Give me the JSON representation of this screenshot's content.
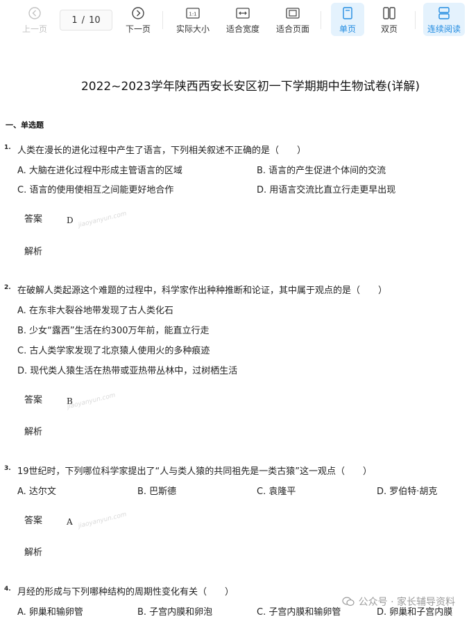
{
  "toolbar": {
    "prev_label": "上一页",
    "page_current": "1",
    "page_sep": "/",
    "page_total": "10",
    "next_label": "下一页",
    "actual_size_label": "实际大小",
    "actual_size_icon_text": "1:1",
    "fit_width_label": "适合宽度",
    "fit_page_label": "适合页面",
    "single_page_label": "单页",
    "double_page_label": "双页",
    "continuous_label": "连续阅读",
    "accent_color": "#1f8ae0"
  },
  "document": {
    "title": "2022~2023学年陕西西安长安区初一下学期期中生物试卷(详解)",
    "section": "一、单选题",
    "answer_label": "答案",
    "explain_label": "解析",
    "watermark": "jiaoyanyun.com",
    "questions": [
      {
        "num": "1.",
        "stem": "人类在漫长的进化过程中产生了语言，下列相关叙述不正确的是（　　）",
        "options": [
          "A. 大脑在进化过程中形成主管语言的区域",
          "B. 语言的产生促进个体间的交流",
          "C. 语言的使用使相互之间能更好地合作",
          "D. 用语言交流比直立行走更早出现"
        ],
        "answer": "D"
      },
      {
        "num": "2.",
        "stem": "在破解人类起源这个难题的过程中，科学家作出种种推断和论证，其中属于观点的是（　　）",
        "options": [
          "A. 在东非大裂谷地带发现了古人类化石",
          "B. 少女“露西”生活在约300万年前，能直立行走",
          "C. 古人类学家发现了北京猿人使用火的多种痕迹",
          "D. 现代类人猿生活在热带或亚热带丛林中，过树栖生活"
        ],
        "answer": "B"
      },
      {
        "num": "3.",
        "stem": "19世纪时，下列哪位科学家提出了“人与类人猿的共同祖先是一类古猿”这一观点（　　）",
        "options": [
          "A. 达尔文",
          "B. 巴斯德",
          "C. 袁隆平",
          "D. 罗伯特·胡克"
        ],
        "answer": "A"
      },
      {
        "num": "4.",
        "stem": "月经的形成与下列哪种结构的周期性变化有关（　　）",
        "options": [
          "A. 卵巢和输卵管",
          "B. 子宫内膜和卵泡",
          "C. 子宫内膜和输卵管",
          "D. 卵巢和子宫内膜"
        ]
      }
    ]
  },
  "footer": {
    "text": "公众号 · 家长辅导资料"
  }
}
